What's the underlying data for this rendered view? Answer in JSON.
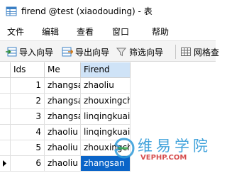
{
  "window": {
    "title": "firend @test (xiaodouding) - 表"
  },
  "menu": [
    "文件",
    "编辑",
    "查看",
    "窗口",
    "帮助"
  ],
  "toolbar": {
    "import_label": "导入向导",
    "export_label": "导出向导",
    "filter_label": "筛选向导",
    "grid_label": "网格查"
  },
  "table": {
    "columns": [
      "Ids",
      "Me",
      "Firend"
    ],
    "rows": [
      {
        "id": "1",
        "me": "zhangsa",
        "firend": "zhaoliu"
      },
      {
        "id": "2",
        "me": "zhangsa",
        "firend": "zhouxingch"
      },
      {
        "id": "3",
        "me": "zhangsa",
        "firend": "linqingkuai"
      },
      {
        "id": "4",
        "me": "zhaoliu",
        "firend": "linqingkuai"
      },
      {
        "id": "5",
        "me": "zhaoliu",
        "firend": "zhouxingch"
      },
      {
        "id": "6",
        "me": "zhaoliu",
        "firend": "zhangsan"
      }
    ]
  },
  "watermark": {
    "text": "维易学院",
    "domain": "VEPHP.COM"
  },
  "colors": {
    "selection": "#0a64c8",
    "header_selected": "#cfe3f7",
    "watermark_blue": "#2f9ad8"
  }
}
